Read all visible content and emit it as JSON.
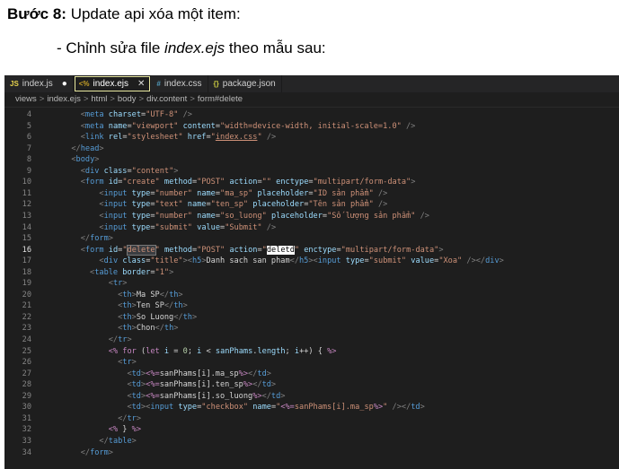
{
  "doc": {
    "step_label": "Bước 8:",
    "step_text": " Update api xóa một item:",
    "instr_prefix": "- Chỉnh sửa file ",
    "instr_file": "index.ejs",
    "instr_suffix": " theo mẫu sau:"
  },
  "tabs": [
    {
      "icon": "JS",
      "label": "index.js",
      "marker": "●"
    },
    {
      "icon": "<%",
      "label": "index.ejs",
      "marker": "✕"
    },
    {
      "icon": "#",
      "label": "index.css",
      "marker": ""
    },
    {
      "icon": "{}",
      "label": "package.json",
      "marker": ""
    }
  ],
  "breadcrumb": [
    "views",
    "index.ejs",
    "html",
    "body",
    "div.content",
    "form#delete"
  ],
  "breadcrumb_sep": ">",
  "lines": [
    {
      "n": "4",
      "h": "    <span class='t'>&lt;</span><span class='tg'>meta</span> <span class='a'>charset</span>=<span class='s'>\"UTF-8\"</span> <span class='t'>/&gt;</span>"
    },
    {
      "n": "5",
      "h": "    <span class='t'>&lt;</span><span class='tg'>meta</span> <span class='a'>name</span>=<span class='s'>\"viewport\"</span> <span class='a'>content</span>=<span class='s'>\"width=device-width, initial-scale=1.0\"</span> <span class='t'>/&gt;</span>"
    },
    {
      "n": "6",
      "h": "    <span class='t'>&lt;</span><span class='tg'>link</span> <span class='a'>rel</span>=<span class='s'>\"stylesheet\"</span> <span class='a'>href</span>=<span class='s'>\"<u>index.css</u>\"</span> <span class='t'>/&gt;</span>"
    },
    {
      "n": "7",
      "h": "  <span class='t'>&lt;/</span><span class='tg'>head</span><span class='t'>&gt;</span>"
    },
    {
      "n": "8",
      "h": "  <span class='t'>&lt;</span><span class='tg'>body</span><span class='t'>&gt;</span>"
    },
    {
      "n": "9",
      "h": "    <span class='t'>&lt;</span><span class='tg'>div</span> <span class='a'>class</span>=<span class='s'>\"content\"</span><span class='t'>&gt;</span>"
    },
    {
      "n": "10",
      "h": "    <span class='t'>&lt;</span><span class='tg'>form</span> <span class='a'>id</span>=<span class='s'>\"create\"</span> <span class='a'>method</span>=<span class='s'>\"POST\"</span> <span class='a'>action</span>=<span class='s'>\"\"</span> <span class='a'>enctype</span>=<span class='s'>\"multipart/form-data\"</span><span class='t'>&gt;</span>"
    },
    {
      "n": "11",
      "h": "        <span class='t'>&lt;</span><span class='tg'>input</span> <span class='a'>type</span>=<span class='s'>\"number\"</span> <span class='a'>name</span>=<span class='s'>\"ma_sp\"</span> <span class='a'>placeholder</span>=<span class='s'>\"ID sản phẩm\"</span> <span class='t'>/&gt;</span>"
    },
    {
      "n": "12",
      "h": "        <span class='t'>&lt;</span><span class='tg'>input</span> <span class='a'>type</span>=<span class='s'>\"text\"</span> <span class='a'>name</span>=<span class='s'>\"ten_sp\"</span> <span class='a'>placeholder</span>=<span class='s'>\"Tên sản phẩm\"</span> <span class='t'>/&gt;</span>"
    },
    {
      "n": "13",
      "h": "        <span class='t'>&lt;</span><span class='tg'>input</span> <span class='a'>type</span>=<span class='s'>\"number\"</span> <span class='a'>name</span>=<span class='s'>\"so_luong\"</span> <span class='a'>placeholder</span>=<span class='s'>\"Số lượng sản phẩm\"</span> <span class='t'>/&gt;</span>"
    },
    {
      "n": "14",
      "h": "        <span class='t'>&lt;</span><span class='tg'>input</span> <span class='a'>type</span>=<span class='s'>\"submit\"</span> <span class='a'>value</span>=<span class='s'>\"Submit\"</span> <span class='t'>/&gt;</span>"
    },
    {
      "n": "15",
      "h": "    <span class='t'>&lt;/</span><span class='tg'>form</span><span class='t'>&gt;</span>"
    },
    {
      "n": "16",
      "h": "    <span class='t'>&lt;</span><span class='tg'>form</span> <span class='a'>id</span>=<span class='s'>\"<span class='hl'>delete</span>\"</span> <span class='a'>method</span>=<span class='s'>\"POST\"</span> <span class='a'>action</span>=<span class='s'>\"<span class='sel'>deletd</span>\"</span> <span class='a'>enctype</span>=<span class='s'>\"multipart/form-data\"</span><span class='t'>&gt;</span>"
    },
    {
      "n": "17",
      "h": "        <span class='t'>&lt;</span><span class='tg'>div</span> <span class='a'>class</span>=<span class='s'>\"title\"</span><span class='t'>&gt;&lt;</span><span class='tg'>h5</span><span class='t'>&gt;</span>Danh sach san pham<span class='t'>&lt;/</span><span class='tg'>h5</span><span class='t'>&gt;&lt;</span><span class='tg'>input</span> <span class='a'>type</span>=<span class='s'>\"submit\"</span> <span class='a'>value</span>=<span class='s'>\"Xoa\"</span> <span class='t'>/&gt;&lt;/</span><span class='tg'>div</span><span class='t'>&gt;</span>"
    },
    {
      "n": "18",
      "h": "      <span class='t'>&lt;</span><span class='tg'>table</span> <span class='a'>border</span>=<span class='s'>\"1\"</span><span class='t'>&gt;</span>"
    },
    {
      "n": "19",
      "h": "          <span class='t'>&lt;</span><span class='tg'>tr</span><span class='t'>&gt;</span>"
    },
    {
      "n": "20",
      "h": "            <span class='t'>&lt;</span><span class='tg'>th</span><span class='t'>&gt;</span>Ma SP<span class='t'>&lt;/</span><span class='tg'>th</span><span class='t'>&gt;</span>"
    },
    {
      "n": "21",
      "h": "            <span class='t'>&lt;</span><span class='tg'>th</span><span class='t'>&gt;</span>Ten SP<span class='t'>&lt;/</span><span class='tg'>th</span><span class='t'>&gt;</span>"
    },
    {
      "n": "22",
      "h": "            <span class='t'>&lt;</span><span class='tg'>th</span><span class='t'>&gt;</span>So Luong<span class='t'>&lt;/</span><span class='tg'>th</span><span class='t'>&gt;</span>"
    },
    {
      "n": "23",
      "h": "            <span class='t'>&lt;</span><span class='tg'>th</span><span class='t'>&gt;</span>Chon<span class='t'>&lt;/</span><span class='tg'>th</span><span class='t'>&gt;</span>"
    },
    {
      "n": "24",
      "h": "          <span class='t'>&lt;/</span><span class='tg'>tr</span><span class='t'>&gt;</span>"
    },
    {
      "n": "25",
      "h": "          <span class='kw'>&lt;%</span> <span class='kw'>for</span> (<span class='kw'>let</span> <span class='v'>i</span> = <span class='n'>0</span>; <span class='v'>i</span> &lt; <span class='v'>sanPhams</span>.<span class='v'>length</span>; <span class='v'>i</span>++) { <span class='kw'>%&gt;</span>"
    },
    {
      "n": "26",
      "h": "            <span class='t'>&lt;</span><span class='tg'>tr</span><span class='t'>&gt;</span>"
    },
    {
      "n": "27",
      "h": "              <span class='t'>&lt;</span><span class='tg'>td</span><span class='t'>&gt;</span><span class='kw'>&lt;%=</span>sanPhams[i].ma_sp<span class='kw'>%&gt;</span><span class='t'>&lt;/</span><span class='tg'>td</span><span class='t'>&gt;</span>"
    },
    {
      "n": "28",
      "h": "              <span class='t'>&lt;</span><span class='tg'>td</span><span class='t'>&gt;</span><span class='kw'>&lt;%=</span>sanPhams[i].ten_sp<span class='kw'>%&gt;</span><span class='t'>&lt;/</span><span class='tg'>td</span><span class='t'>&gt;</span>"
    },
    {
      "n": "29",
      "h": "              <span class='t'>&lt;</span><span class='tg'>td</span><span class='t'>&gt;</span><span class='kw'>&lt;%=</span>sanPhams[i].so_luong<span class='kw'>%&gt;</span><span class='t'>&lt;/</span><span class='tg'>td</span><span class='t'>&gt;</span>"
    },
    {
      "n": "30",
      "h": "              <span class='t'>&lt;</span><span class='tg'>td</span><span class='t'>&gt;&lt;</span><span class='tg'>input</span> <span class='a'>type</span>=<span class='s'>\"checkbox\"</span> <span class='a'>name</span>=<span class='s'>\"<span class='kw'>&lt;%=</span>sanPhams[i].ma_sp<span class='kw'>%&gt;</span>\"</span> <span class='t'>/&gt;&lt;/</span><span class='tg'>td</span><span class='t'>&gt;</span>"
    },
    {
      "n": "31",
      "h": "            <span class='t'>&lt;/</span><span class='tg'>tr</span><span class='t'>&gt;</span>"
    },
    {
      "n": "32",
      "h": "          <span class='kw'>&lt;%</span> } <span class='kw'>%&gt;</span>"
    },
    {
      "n": "33",
      "h": "        <span class='t'>&lt;/</span><span class='tg'>table</span><span class='t'>&gt;</span>"
    },
    {
      "n": "34",
      "h": "    <span class='t'>&lt;/</span><span class='tg'>form</span><span class='t'>&gt;</span>"
    }
  ],
  "current_line": "16"
}
